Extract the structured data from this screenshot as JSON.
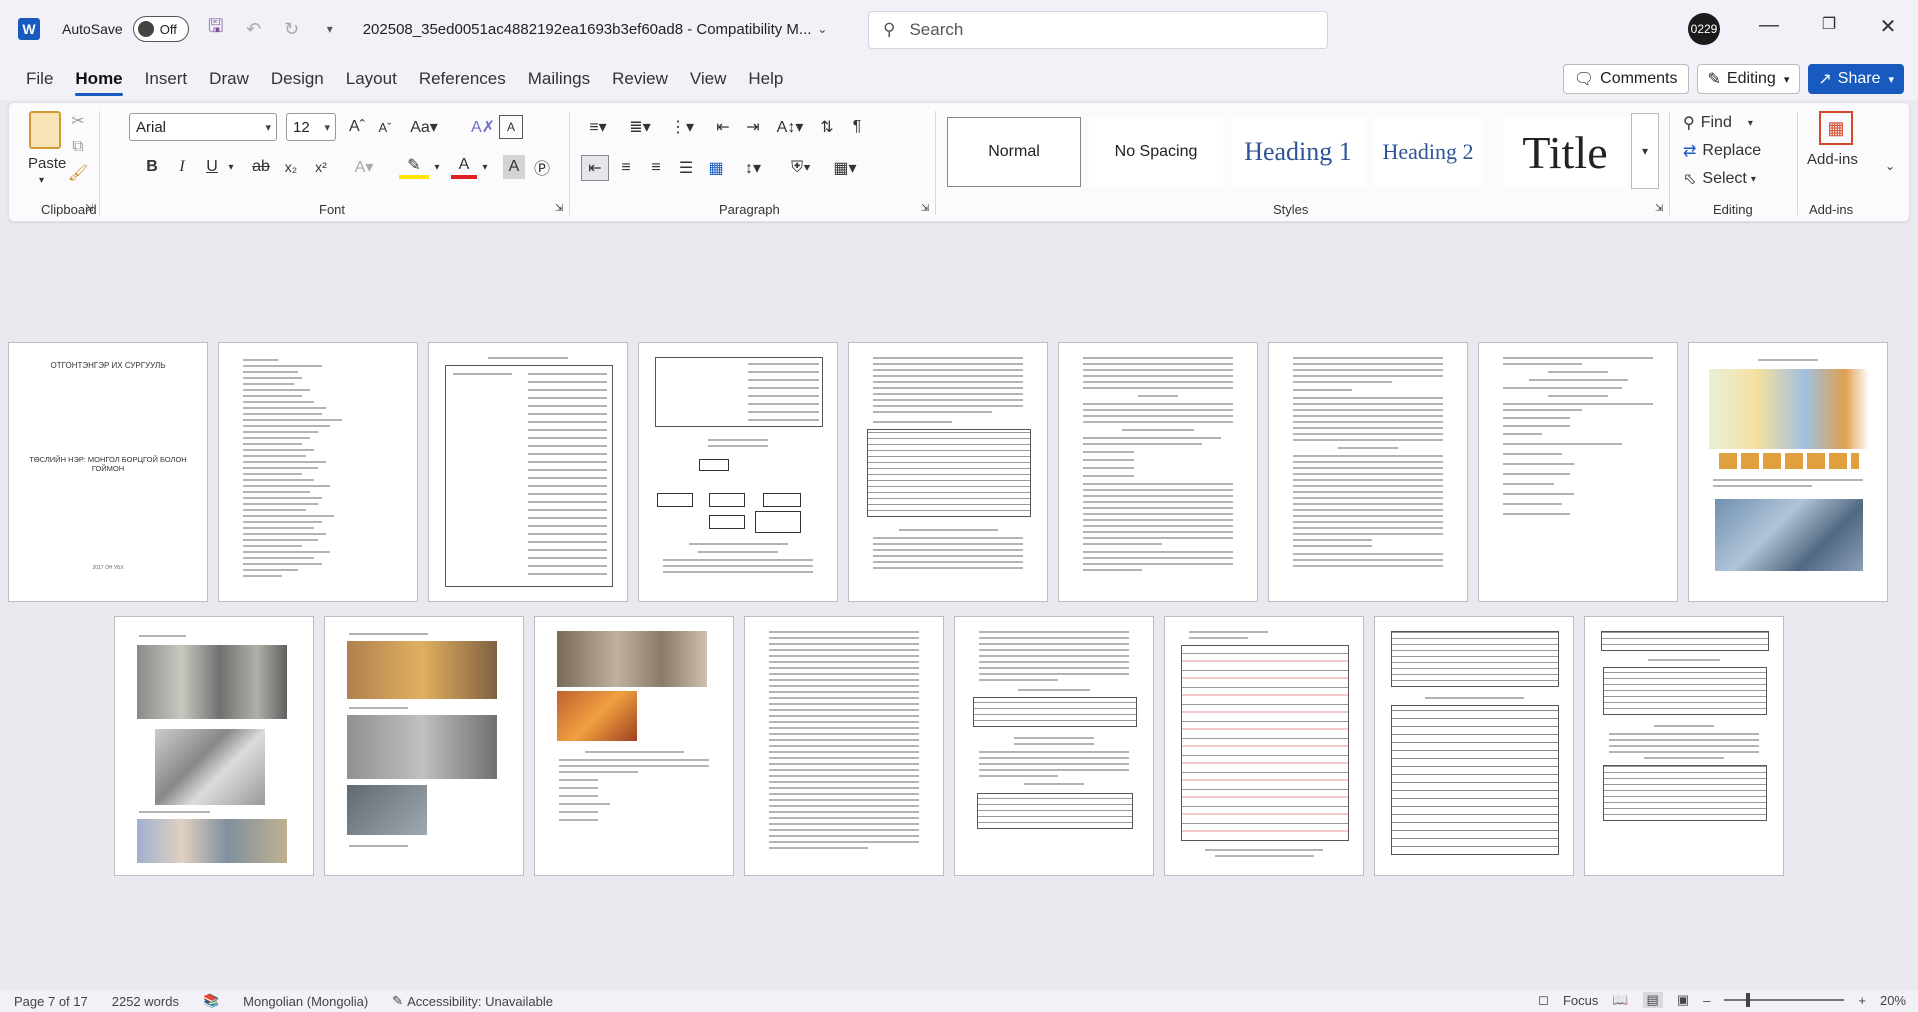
{
  "titlebar": {
    "autosave_label": "AutoSave",
    "autosave_state": "Off",
    "doc_title": "202508_35ed0051ac4882192ea1693b3ef60ad8  -  Compatibility M...",
    "search_placeholder": "Search",
    "user_badge": "0229"
  },
  "tabs": [
    "File",
    "Home",
    "Insert",
    "Draw",
    "Design",
    "Layout",
    "References",
    "Mailings",
    "Review",
    "View",
    "Help"
  ],
  "actions": {
    "comments": "Comments",
    "editing": "Editing",
    "share": "Share"
  },
  "ribbon": {
    "clipboard": {
      "paste": "Paste",
      "label": "Clipboard"
    },
    "font": {
      "name": "Arial",
      "size": "12",
      "label": "Font"
    },
    "paragraph": {
      "label": "Paragraph"
    },
    "styles": {
      "normal": "Normal",
      "no_spacing": "No Spacing",
      "heading1": "Heading 1",
      "heading2": "Heading 2",
      "title": "Title",
      "label": "Styles"
    },
    "editing": {
      "find": "Find",
      "replace": "Replace",
      "select": "Select",
      "label": "Editing"
    },
    "addins": {
      "button": "Add-ins",
      "label": "Add-ins"
    }
  },
  "pages": {
    "cover_university": "ОТГОНТЭНГЭР ИХ СУРГУУЛЬ",
    "cover_title": "ТӨСЛИЙН НЭР: МОНГОЛ БОРЦГОЙ БОЛОН ГОЙМОН",
    "cover_year": "2017 ОН УБХ"
  },
  "status": {
    "page": "Page 7 of 17",
    "words": "2252 words",
    "language": "Mongolian (Mongolia)",
    "accessibility": "Accessibility: Unavailable",
    "focus": "Focus",
    "zoom": "20%"
  }
}
